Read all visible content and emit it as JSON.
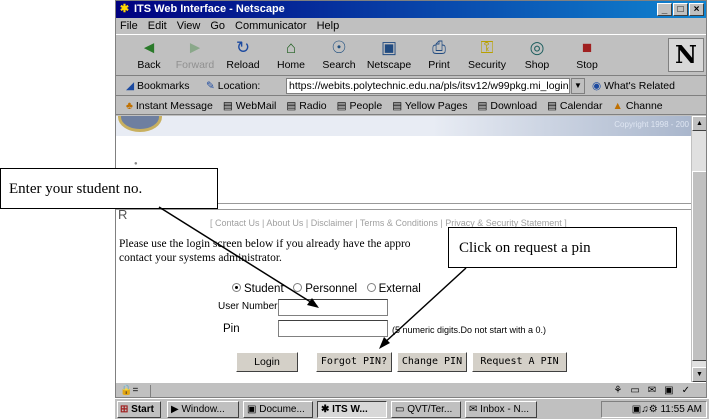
{
  "window": {
    "title": "ITS Web Interface - Netscape",
    "buttons": [
      "_",
      "□",
      "×"
    ]
  },
  "menu": [
    "File",
    "Edit",
    "View",
    "Go",
    "Communicator",
    "Help"
  ],
  "toolbar": {
    "buttons": [
      {
        "label": "Back",
        "icon": "back-arrow-icon",
        "glyph": "◄"
      },
      {
        "label": "Forward",
        "icon": "forward-arrow-icon",
        "glyph": "►"
      },
      {
        "label": "Reload",
        "icon": "reload-icon",
        "glyph": "↻"
      },
      {
        "label": "Home",
        "icon": "home-icon",
        "glyph": "⌂"
      },
      {
        "label": "Search",
        "icon": "search-icon",
        "glyph": "☉"
      },
      {
        "label": "Netscape",
        "icon": "netscape-icon",
        "glyph": "▣"
      },
      {
        "label": "Print",
        "icon": "print-icon",
        "glyph": "⎙"
      },
      {
        "label": "Security",
        "icon": "lock-icon",
        "glyph": "⚿"
      },
      {
        "label": "Shop",
        "icon": "shop-icon",
        "glyph": "◎"
      },
      {
        "label": "Stop",
        "icon": "stop-icon",
        "glyph": "■"
      }
    ],
    "logo": "N"
  },
  "location": {
    "bookmarks": "Bookmarks",
    "label": "Location:",
    "url": "https://webits.polytechnic.edu.na/pls/itsv12/w99pkg.mi_login",
    "related": "What's Related"
  },
  "personal_toolbar": [
    "Instant Message",
    "WebMail",
    "Radio",
    "People",
    "Yellow Pages",
    "Download",
    "Calendar",
    "Channe"
  ],
  "page": {
    "copyright": "Copyright 1998 - 200",
    "links": "[ Contact Us | About Us | Disclaimer | Terms & Conditions | Privacy & Security Statement ]",
    "intro": "Please use the login screen below if you already have the appro... contact your systems administrator.",
    "intro_line1": "Please use the login screen below if you already have the appro",
    "intro_line2": "contact your systems administrator.",
    "user_types": [
      "Student",
      "Personnel",
      "External"
    ],
    "selected_user_type": "Student",
    "user_number_label": "User Number",
    "user_number_value": "",
    "pin_label": "Pin",
    "pin_value": "",
    "pin_hint": "(5 numeric digits.Do not start with a 0.)",
    "buttons": [
      "Login",
      "Forgot PIN?",
      "Change PIN",
      "Request A PIN"
    ],
    "r_letter": "R"
  },
  "annotations": {
    "callout_student": "Enter your student no.",
    "callout_pin": "Click on request a  pin"
  },
  "taskbar": {
    "start": "Start",
    "tasks": [
      "Window...",
      "Docume...",
      "ITS W...",
      "QVT/Ter...",
      "Inbox - N..."
    ],
    "time": "11:55 AM"
  }
}
